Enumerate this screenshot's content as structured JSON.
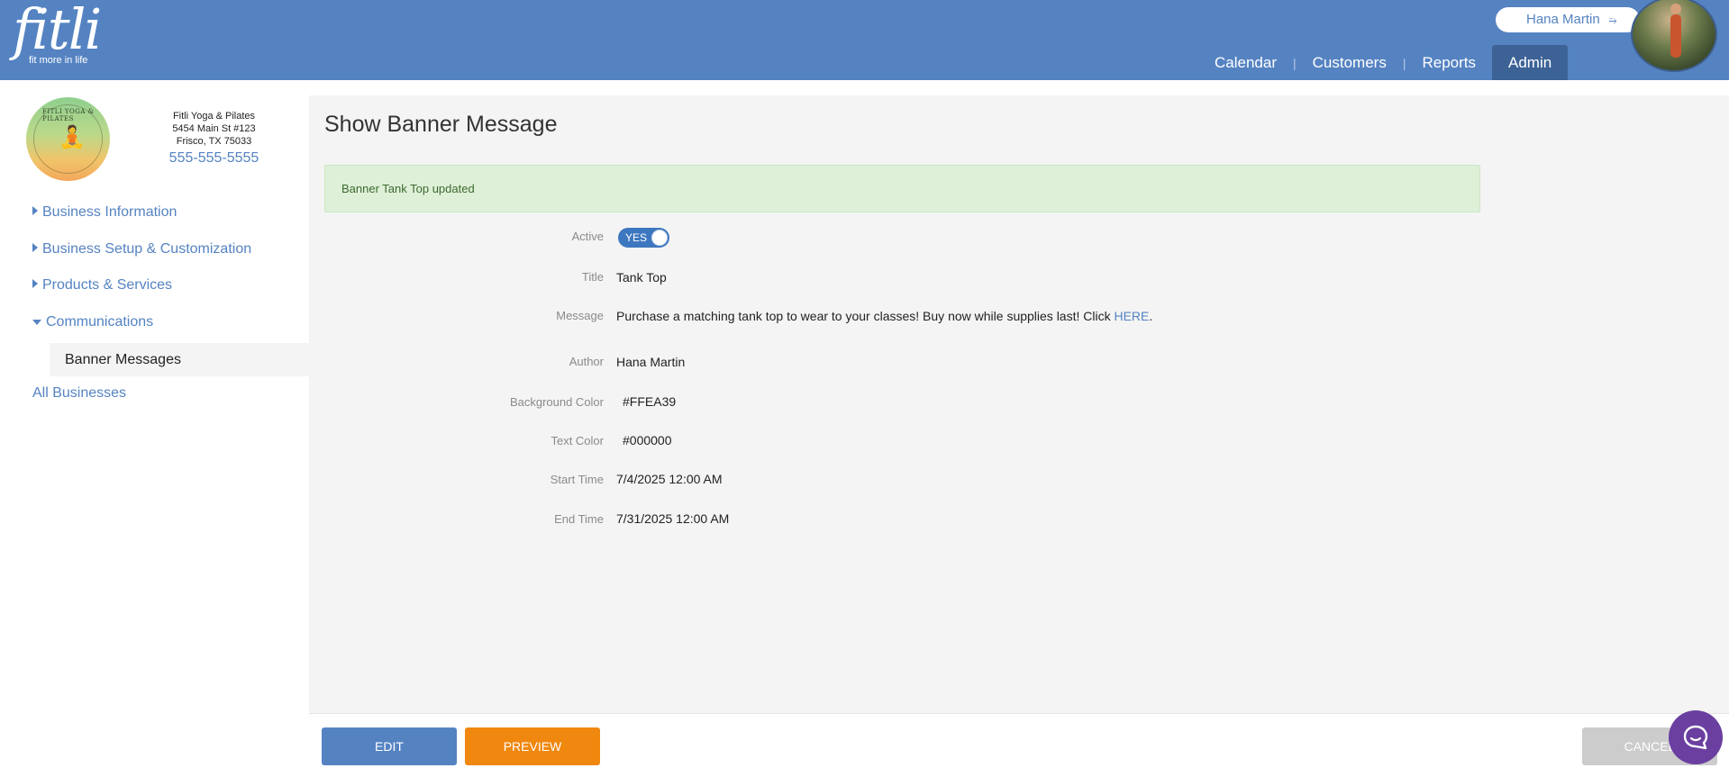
{
  "header": {
    "logo_word": "fitli",
    "logo_tagline": "fit more in life",
    "user_name": "Hana Martin",
    "nav": [
      {
        "label": "Calendar"
      },
      {
        "label": "Customers"
      },
      {
        "label": "Reports"
      },
      {
        "label": "Admin",
        "active": true
      }
    ]
  },
  "business": {
    "logo_text": "FITLI YOGA & PILATES",
    "name": "Fitli Yoga & Pilates",
    "address_line1": "5454 Main St #123",
    "address_line2": "Frisco, TX 75033",
    "phone": "555-555-5555"
  },
  "sidebar": {
    "items": [
      {
        "label": "Business Information"
      },
      {
        "label": "Business Setup & Customization"
      },
      {
        "label": "Products & Services"
      },
      {
        "label": "Communications",
        "expanded": true
      }
    ],
    "sub_item": "Banner Messages",
    "all_businesses": "All Businesses"
  },
  "main": {
    "page_title": "Show Banner Message",
    "alert": "Banner Tank Top updated",
    "fields": {
      "active_label": "Active",
      "active_value": "YES",
      "title_label": "Title",
      "title_value": "Tank Top",
      "message_label": "Message",
      "message_value": "Purchase a matching tank top to wear to your classes! Buy now while supplies last! Click ",
      "message_link": "HERE",
      "message_end": ".",
      "author_label": "Author",
      "author_value": "Hana Martin",
      "bg_color_label": "Background Color",
      "bg_color_value": "#FFEA39",
      "text_color_label": "Text Color",
      "text_color_value": "#000000",
      "start_label": "Start Time",
      "start_value": "7/4/2025 12:00 AM",
      "end_label": "End Time",
      "end_value": "7/31/2025 12:00 AM"
    }
  },
  "footer": {
    "edit": "EDIT",
    "preview": "PREVIEW",
    "cancel": "CANCEL"
  },
  "colors": {
    "brand_blue": "#5583c2",
    "admin_tab": "#3d6396",
    "preview_orange": "#f0870e",
    "success_bg": "#dff0d8",
    "chat_purple": "#6a3fa0"
  },
  "icons": [
    "chevron-down-icon",
    "user-avatar",
    "caret-right-icon",
    "caret-down-icon",
    "chat-bubble-icon"
  ]
}
